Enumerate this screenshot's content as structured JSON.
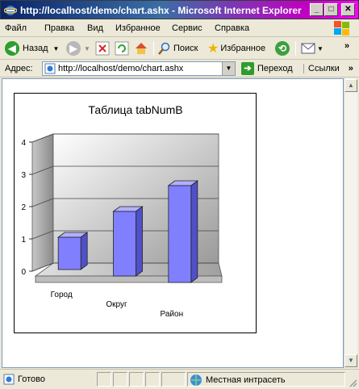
{
  "window": {
    "title": "http://localhost/demo/chart.ashx - Microsoft Internet Explorer",
    "controls": {
      "minimize": "_",
      "maximize": "□",
      "close": "✕"
    }
  },
  "menu": {
    "items": [
      "Файл",
      "Правка",
      "Вид",
      "Избранное",
      "Сервис",
      "Справка"
    ]
  },
  "toolbar": {
    "back_label": "Назад",
    "search_label": "Поиск",
    "favorites_label": "Избранное",
    "overflow": "»"
  },
  "address": {
    "label": "Адрес:",
    "url": "http://localhost/demo/chart.ashx",
    "go_label": "Переход",
    "links_label": "Ссылки",
    "links_overflow": "»"
  },
  "status": {
    "ready": "Готово",
    "zone": "Местная интрасеть"
  },
  "chart_data": {
    "type": "bar",
    "title": "Таблица tabNumB",
    "categories": [
      "Город",
      "Округ",
      "Район"
    ],
    "values": [
      1,
      2,
      3
    ],
    "ylim": [
      0,
      4
    ],
    "yticks": [
      0,
      1,
      2,
      3,
      4
    ],
    "xlabel": "",
    "ylabel": "",
    "legend": "none",
    "grid": true,
    "style": "3d",
    "bar_color": "#8080FF"
  }
}
